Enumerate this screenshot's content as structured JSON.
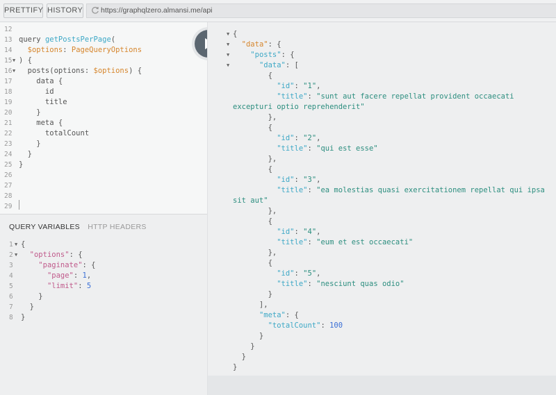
{
  "toolbar": {
    "prettify_label": "PRETTIFY",
    "history_label": "HISTORY",
    "url": "https://graphqlzero.almansi.me/api"
  },
  "query_editor": {
    "lines": [
      {
        "num": "12",
        "fold": false,
        "tokens": []
      },
      {
        "num": "13",
        "fold": false,
        "tokens": [
          {
            "t": "query ",
            "c": "p"
          },
          {
            "t": "getPostsPerPage",
            "c": "kw-def"
          },
          {
            "t": "(",
            "c": "p"
          }
        ]
      },
      {
        "num": "14",
        "fold": false,
        "tokens": [
          {
            "t": "  ",
            "c": "p"
          },
          {
            "t": "$options",
            "c": "kw-var"
          },
          {
            "t": ": ",
            "c": "p"
          },
          {
            "t": "PageQueryOptions",
            "c": "kw-var"
          }
        ]
      },
      {
        "num": "15",
        "fold": true,
        "tokens": [
          {
            "t": ") {",
            "c": "p"
          }
        ]
      },
      {
        "num": "16",
        "fold": true,
        "tokens": [
          {
            "t": "  posts(",
            "c": "p"
          },
          {
            "t": "options",
            "c": "p"
          },
          {
            "t": ": ",
            "c": "p"
          },
          {
            "t": "$options",
            "c": "kw-var"
          },
          {
            "t": ") {",
            "c": "p"
          }
        ]
      },
      {
        "num": "17",
        "fold": false,
        "tokens": [
          {
            "t": "    data {",
            "c": "p"
          }
        ]
      },
      {
        "num": "18",
        "fold": false,
        "tokens": [
          {
            "t": "      id",
            "c": "p"
          }
        ]
      },
      {
        "num": "19",
        "fold": false,
        "tokens": [
          {
            "t": "      title",
            "c": "p"
          }
        ]
      },
      {
        "num": "20",
        "fold": false,
        "tokens": [
          {
            "t": "    }",
            "c": "p"
          }
        ]
      },
      {
        "num": "21",
        "fold": false,
        "tokens": [
          {
            "t": "    meta {",
            "c": "p"
          }
        ]
      },
      {
        "num": "22",
        "fold": false,
        "tokens": [
          {
            "t": "      totalCount",
            "c": "p"
          }
        ]
      },
      {
        "num": "23",
        "fold": false,
        "tokens": [
          {
            "t": "    }",
            "c": "p"
          }
        ]
      },
      {
        "num": "24",
        "fold": false,
        "tokens": [
          {
            "t": "  }",
            "c": "p"
          }
        ]
      },
      {
        "num": "25",
        "fold": false,
        "tokens": [
          {
            "t": "}",
            "c": "p"
          }
        ]
      },
      {
        "num": "26",
        "fold": false,
        "tokens": []
      },
      {
        "num": "27",
        "fold": false,
        "tokens": []
      },
      {
        "num": "28",
        "fold": false,
        "tokens": []
      },
      {
        "num": "29",
        "fold": false,
        "tokens": []
      }
    ]
  },
  "variables_panel": {
    "tab_query_variables": "QUERY VARIABLES",
    "tab_http_headers": "HTTP HEADERS",
    "lines": [
      {
        "num": "1",
        "fold": true,
        "tokens": [
          {
            "t": "{",
            "c": "p"
          }
        ]
      },
      {
        "num": "2",
        "fold": true,
        "tokens": [
          {
            "t": "  ",
            "c": "p"
          },
          {
            "t": "\"options\"",
            "c": "k"
          },
          {
            "t": ": {",
            "c": "p"
          }
        ]
      },
      {
        "num": "3",
        "fold": false,
        "tokens": [
          {
            "t": "    ",
            "c": "p"
          },
          {
            "t": "\"paginate\"",
            "c": "k"
          },
          {
            "t": ": {",
            "c": "p"
          }
        ]
      },
      {
        "num": "4",
        "fold": false,
        "tokens": [
          {
            "t": "      ",
            "c": "p"
          },
          {
            "t": "\"page\"",
            "c": "k"
          },
          {
            "t": ": ",
            "c": "p"
          },
          {
            "t": "1",
            "c": "n"
          },
          {
            "t": ",",
            "c": "p"
          }
        ]
      },
      {
        "num": "5",
        "fold": false,
        "tokens": [
          {
            "t": "      ",
            "c": "p"
          },
          {
            "t": "\"limit\"",
            "c": "k"
          },
          {
            "t": ": ",
            "c": "p"
          },
          {
            "t": "5",
            "c": "n"
          }
        ]
      },
      {
        "num": "6",
        "fold": false,
        "tokens": [
          {
            "t": "    }",
            "c": "p"
          }
        ]
      },
      {
        "num": "7",
        "fold": false,
        "tokens": [
          {
            "t": "  }",
            "c": "p"
          }
        ]
      },
      {
        "num": "8",
        "fold": false,
        "tokens": [
          {
            "t": "}",
            "c": "p"
          }
        ]
      }
    ]
  },
  "result_panel": {
    "lines": [
      {
        "fold": true,
        "tokens": [
          {
            "t": "{",
            "c": "p"
          }
        ]
      },
      {
        "fold": true,
        "tokens": [
          {
            "t": "  ",
            "c": "p"
          },
          {
            "t": "\"data\"",
            "c": "kw-var"
          },
          {
            "t": ": {",
            "c": "p"
          }
        ]
      },
      {
        "fold": true,
        "tokens": [
          {
            "t": "    ",
            "c": "p"
          },
          {
            "t": "\"posts\"",
            "c": "kw-def"
          },
          {
            "t": ": {",
            "c": "p"
          }
        ]
      },
      {
        "fold": true,
        "tokens": [
          {
            "t": "      ",
            "c": "p"
          },
          {
            "t": "\"data\"",
            "c": "kw-def"
          },
          {
            "t": ": [",
            "c": "p"
          }
        ]
      },
      {
        "fold": false,
        "tokens": [
          {
            "t": "        {",
            "c": "p"
          }
        ]
      },
      {
        "fold": false,
        "tokens": [
          {
            "t": "          ",
            "c": "p"
          },
          {
            "t": "\"id\"",
            "c": "kw-def"
          },
          {
            "t": ": ",
            "c": "p"
          },
          {
            "t": "\"1\"",
            "c": "s"
          },
          {
            "t": ",",
            "c": "p"
          }
        ]
      },
      {
        "fold": false,
        "tokens": [
          {
            "t": "          ",
            "c": "p"
          },
          {
            "t": "\"title\"",
            "c": "kw-def"
          },
          {
            "t": ": ",
            "c": "p"
          },
          {
            "t": "\"sunt aut facere repellat provident occaecati",
            "c": "s"
          }
        ]
      },
      {
        "fold": false,
        "tokens": [
          {
            "t": "excepturi optio reprehenderit\"",
            "c": "s"
          }
        ]
      },
      {
        "fold": false,
        "tokens": [
          {
            "t": "        },",
            "c": "p"
          }
        ]
      },
      {
        "fold": false,
        "tokens": [
          {
            "t": "        {",
            "c": "p"
          }
        ]
      },
      {
        "fold": false,
        "tokens": [
          {
            "t": "          ",
            "c": "p"
          },
          {
            "t": "\"id\"",
            "c": "kw-def"
          },
          {
            "t": ": ",
            "c": "p"
          },
          {
            "t": "\"2\"",
            "c": "s"
          },
          {
            "t": ",",
            "c": "p"
          }
        ]
      },
      {
        "fold": false,
        "tokens": [
          {
            "t": "          ",
            "c": "p"
          },
          {
            "t": "\"title\"",
            "c": "kw-def"
          },
          {
            "t": ": ",
            "c": "p"
          },
          {
            "t": "\"qui est esse\"",
            "c": "s"
          }
        ]
      },
      {
        "fold": false,
        "tokens": [
          {
            "t": "        },",
            "c": "p"
          }
        ]
      },
      {
        "fold": false,
        "tokens": [
          {
            "t": "        {",
            "c": "p"
          }
        ]
      },
      {
        "fold": false,
        "tokens": [
          {
            "t": "          ",
            "c": "p"
          },
          {
            "t": "\"id\"",
            "c": "kw-def"
          },
          {
            "t": ": ",
            "c": "p"
          },
          {
            "t": "\"3\"",
            "c": "s"
          },
          {
            "t": ",",
            "c": "p"
          }
        ]
      },
      {
        "fold": false,
        "tokens": [
          {
            "t": "          ",
            "c": "p"
          },
          {
            "t": "\"title\"",
            "c": "kw-def"
          },
          {
            "t": ": ",
            "c": "p"
          },
          {
            "t": "\"ea molestias quasi exercitationem repellat qui ipsa",
            "c": "s"
          }
        ]
      },
      {
        "fold": false,
        "tokens": [
          {
            "t": "sit aut\"",
            "c": "s"
          }
        ]
      },
      {
        "fold": false,
        "tokens": [
          {
            "t": "        },",
            "c": "p"
          }
        ]
      },
      {
        "fold": false,
        "tokens": [
          {
            "t": "        {",
            "c": "p"
          }
        ]
      },
      {
        "fold": false,
        "tokens": [
          {
            "t": "          ",
            "c": "p"
          },
          {
            "t": "\"id\"",
            "c": "kw-def"
          },
          {
            "t": ": ",
            "c": "p"
          },
          {
            "t": "\"4\"",
            "c": "s"
          },
          {
            "t": ",",
            "c": "p"
          }
        ]
      },
      {
        "fold": false,
        "tokens": [
          {
            "t": "          ",
            "c": "p"
          },
          {
            "t": "\"title\"",
            "c": "kw-def"
          },
          {
            "t": ": ",
            "c": "p"
          },
          {
            "t": "\"eum et est occaecati\"",
            "c": "s"
          }
        ]
      },
      {
        "fold": false,
        "tokens": [
          {
            "t": "        },",
            "c": "p"
          }
        ]
      },
      {
        "fold": false,
        "tokens": [
          {
            "t": "        {",
            "c": "p"
          }
        ]
      },
      {
        "fold": false,
        "tokens": [
          {
            "t": "          ",
            "c": "p"
          },
          {
            "t": "\"id\"",
            "c": "kw-def"
          },
          {
            "t": ": ",
            "c": "p"
          },
          {
            "t": "\"5\"",
            "c": "s"
          },
          {
            "t": ",",
            "c": "p"
          }
        ]
      },
      {
        "fold": false,
        "tokens": [
          {
            "t": "          ",
            "c": "p"
          },
          {
            "t": "\"title\"",
            "c": "kw-def"
          },
          {
            "t": ": ",
            "c": "p"
          },
          {
            "t": "\"nesciunt quas odio\"",
            "c": "s"
          }
        ]
      },
      {
        "fold": false,
        "tokens": [
          {
            "t": "        }",
            "c": "p"
          }
        ]
      },
      {
        "fold": false,
        "tokens": [
          {
            "t": "      ],",
            "c": "p"
          }
        ]
      },
      {
        "fold": false,
        "tokens": [
          {
            "t": "      ",
            "c": "p"
          },
          {
            "t": "\"meta\"",
            "c": "kw-def"
          },
          {
            "t": ": {",
            "c": "p"
          }
        ]
      },
      {
        "fold": false,
        "tokens": [
          {
            "t": "        ",
            "c": "p"
          },
          {
            "t": "\"totalCount\"",
            "c": "kw-def"
          },
          {
            "t": ": ",
            "c": "p"
          },
          {
            "t": "100",
            "c": "n"
          }
        ]
      },
      {
        "fold": false,
        "tokens": [
          {
            "t": "      }",
            "c": "p"
          }
        ]
      },
      {
        "fold": false,
        "tokens": [
          {
            "t": "    }",
            "c": "p"
          }
        ]
      },
      {
        "fold": false,
        "tokens": [
          {
            "t": "  }",
            "c": "p"
          }
        ]
      },
      {
        "fold": false,
        "tokens": [
          {
            "t": "}",
            "c": "p"
          }
        ]
      }
    ]
  },
  "icons": {
    "history_refresh": "refresh-icon",
    "run": "play-icon",
    "fold": "triangle-down-icon"
  }
}
